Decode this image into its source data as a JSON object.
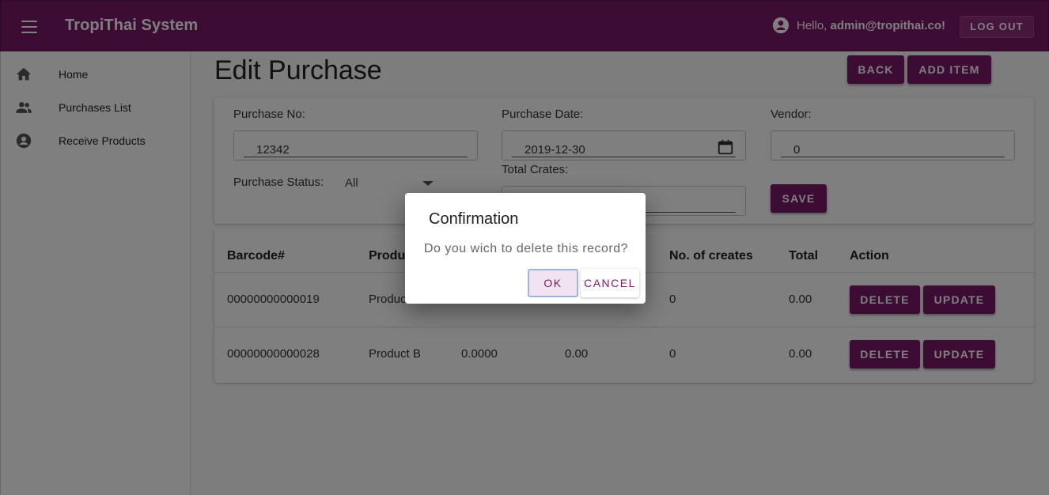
{
  "appbar": {
    "title": "TropiThai System",
    "hello_prefix": "Hello, ",
    "user_email": "admin@tropithai.co!",
    "logout_label": "LOG OUT"
  },
  "sidebar": {
    "items": [
      {
        "label": "Home",
        "icon": "home-icon"
      },
      {
        "label": "Purchases List",
        "icon": "people-icon"
      },
      {
        "label": "Receive Products",
        "icon": "account-circle-icon"
      }
    ]
  },
  "page": {
    "title": "Edit Purchase",
    "back_label": "BACK",
    "add_item_label": "ADD ITEM"
  },
  "form": {
    "purchase_no_label": "Purchase No:",
    "purchase_no_value": "12342",
    "purchase_date_label": "Purchase Date:",
    "purchase_date_value": "2019-12-30",
    "vendor_label": "Vendor:",
    "vendor_value": "0",
    "status_label": "Purchase Status:",
    "status_value": "All",
    "total_crates_label": "Total Crates:",
    "total_crates_value": "",
    "save_label": "SAVE"
  },
  "table": {
    "headers": [
      "Barcode#",
      "Produc",
      "No. of creates",
      "Total",
      "Action"
    ],
    "rows": [
      {
        "barcode": "00000000000019",
        "product": "Produc",
        "price": "",
        "amount": "",
        "crates": "0",
        "total": "0.00",
        "delete": "DELETE",
        "update": "UPDATE"
      },
      {
        "barcode": "00000000000028",
        "product": "Product B",
        "price": "0.0000",
        "amount": "0.00",
        "crates": "0",
        "total": "0.00",
        "delete": "DELETE",
        "update": "UPDATE"
      }
    ]
  },
  "dialog": {
    "title": "Confirmation",
    "message": "Do you wich to delete this record?",
    "ok_label": "OK",
    "cancel_label": "CANCEL"
  },
  "colors": {
    "primary": "#7b1868",
    "overlay": "rgba(0,0,0,0.5)"
  }
}
